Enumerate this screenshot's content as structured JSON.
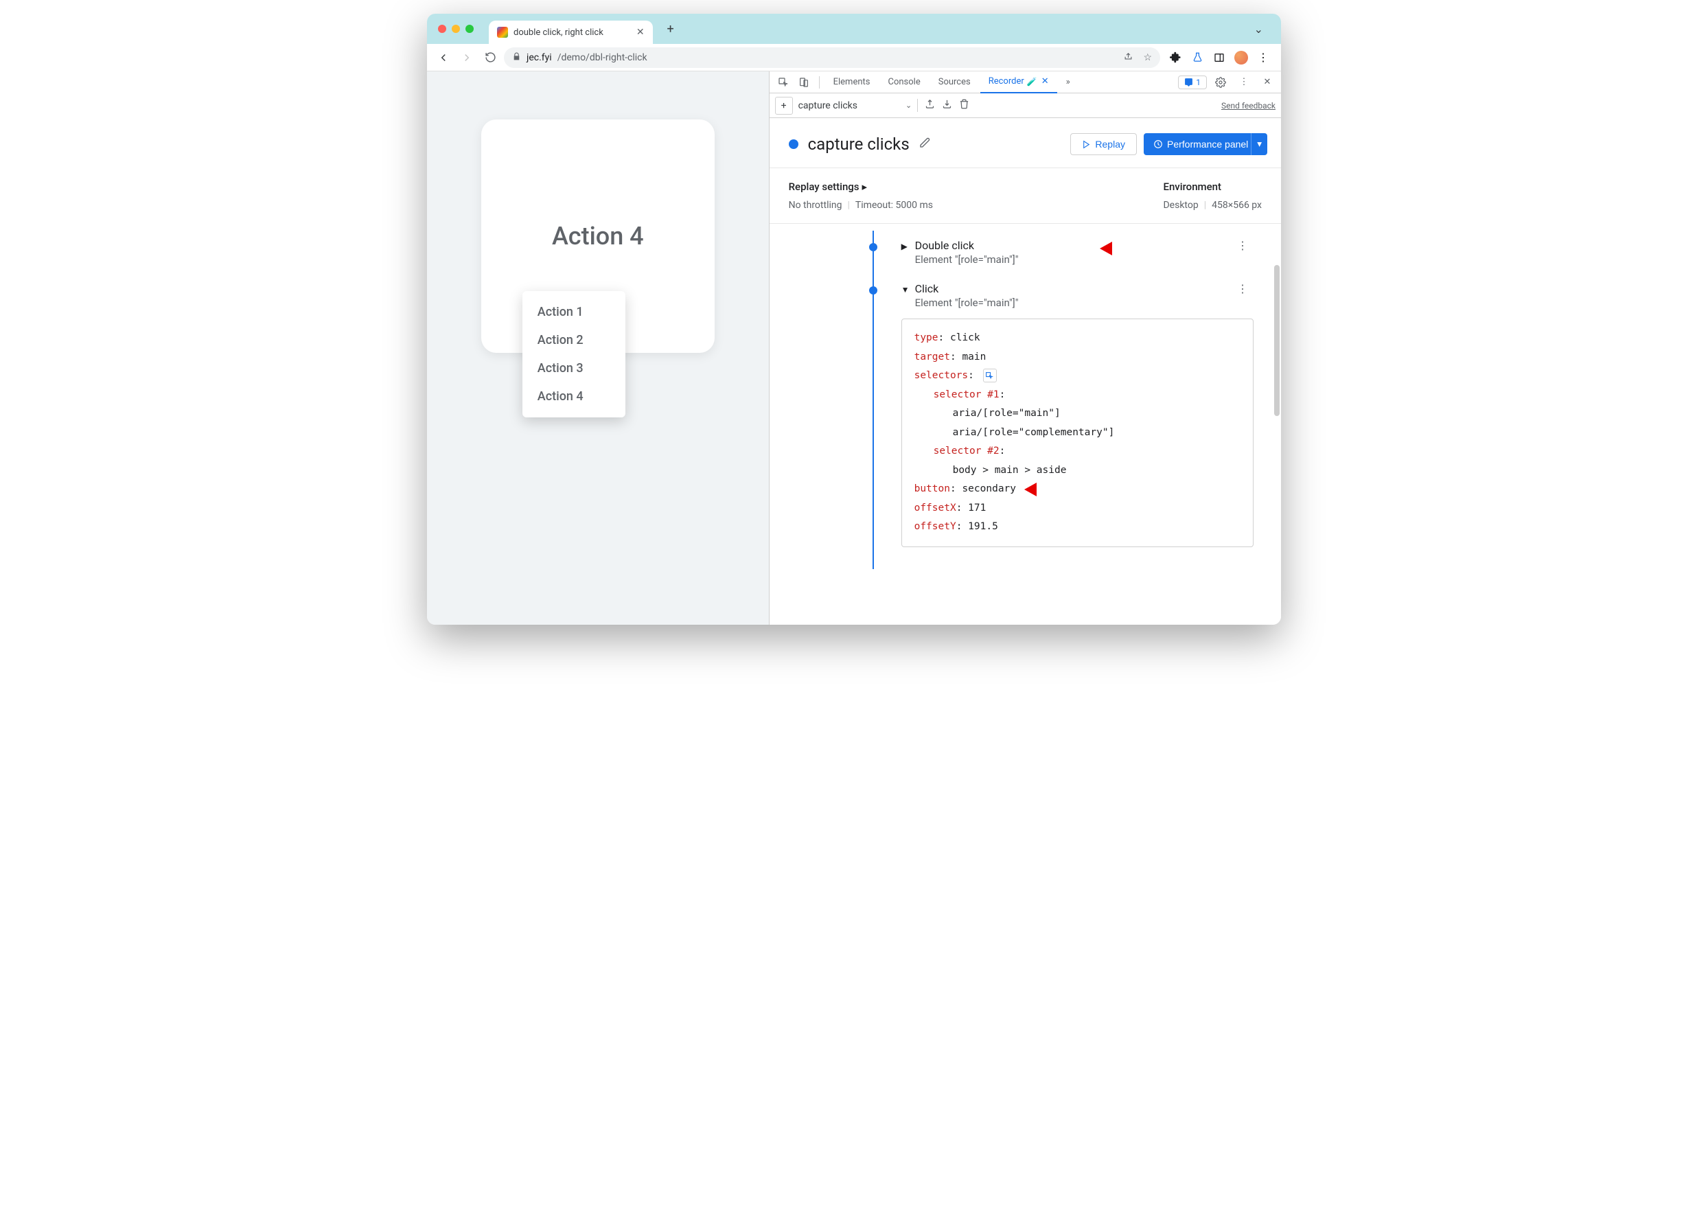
{
  "browser": {
    "tab_title": "double click, right click",
    "url_domain": "jec.fyi",
    "url_path": "/demo/dbl-right-click"
  },
  "page": {
    "card_title": "Action 4",
    "menu_items": [
      "Action 1",
      "Action 2",
      "Action 3",
      "Action 4"
    ]
  },
  "devtools": {
    "tabs": {
      "elements": "Elements",
      "console": "Console",
      "sources": "Sources",
      "recorder": "Recorder"
    },
    "issues_count": "1",
    "recorder": {
      "dropdown": "capture clicks",
      "feedback": "Send feedback",
      "title": "capture clicks",
      "replay_btn": "Replay",
      "perf_btn": "Performance panel",
      "settings": {
        "heading": "Replay settings",
        "throttling": "No throttling",
        "timeout": "Timeout: 5000 ms"
      },
      "env": {
        "heading": "Environment",
        "device": "Desktop",
        "size": "458×566 px"
      },
      "steps": [
        {
          "title": "Double click",
          "subtitle": "Element \"[role=\"main\"]\"",
          "expanded": false
        },
        {
          "title": "Click",
          "subtitle": "Element \"[role=\"main\"]\"",
          "expanded": true,
          "details": {
            "type_k": "type",
            "type_v": "click",
            "target_k": "target",
            "target_v": "main",
            "selectors_k": "selectors",
            "sel1_k": "selector #1",
            "sel1_a": "aria/[role=\"main\"]",
            "sel1_b": "aria/[role=\"complementary\"]",
            "sel2_k": "selector #2",
            "sel2_a": "body > main > aside",
            "button_k": "button",
            "button_v": "secondary",
            "offsetx_k": "offsetX",
            "offsetx_v": "171",
            "offsety_k": "offsetY",
            "offsety_v": "191.5"
          }
        }
      ]
    }
  }
}
